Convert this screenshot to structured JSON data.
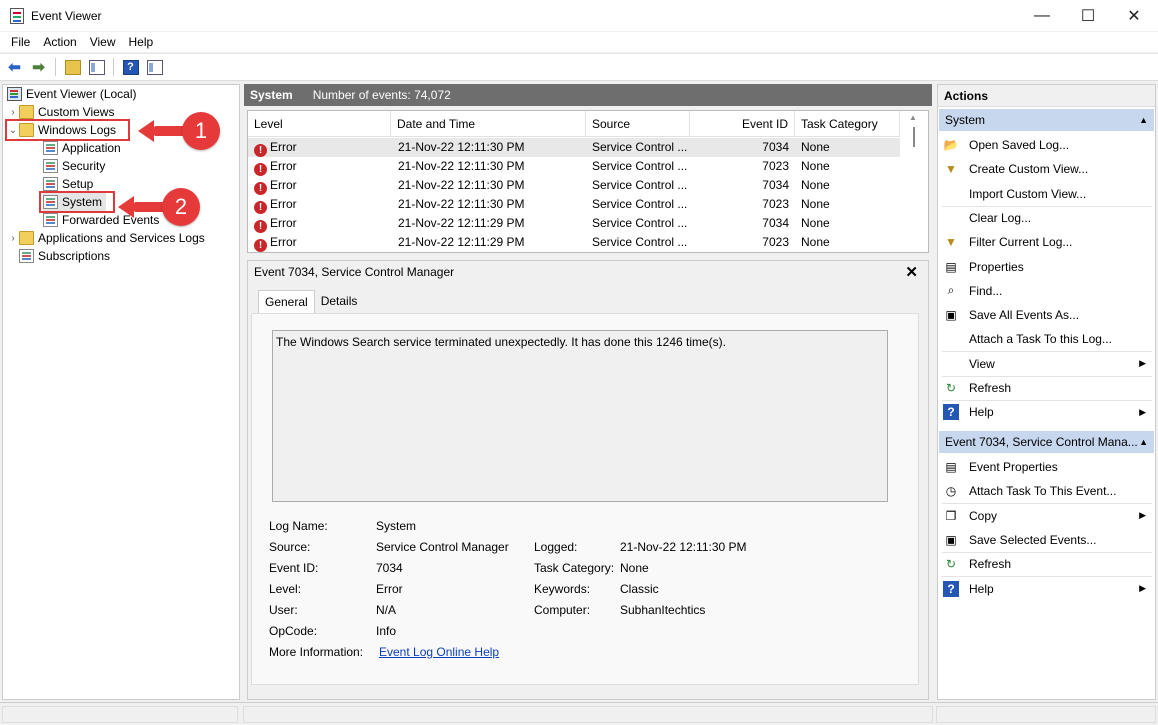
{
  "window": {
    "title": "Event Viewer",
    "minimize": "—",
    "maximize": "☐",
    "close": "✕"
  },
  "menu": [
    "File",
    "Action",
    "View",
    "Help"
  ],
  "tree": {
    "root": "Event Viewer (Local)",
    "custom_views": "Custom Views",
    "windows_logs": "Windows Logs",
    "application": "Application",
    "security": "Security",
    "setup": "Setup",
    "system": "System",
    "forwarded": "Forwarded Events",
    "apps_services": "Applications and Services Logs",
    "subscriptions": "Subscriptions"
  },
  "callouts": {
    "one": "1",
    "two": "2",
    "color": "#e63a3a"
  },
  "middle": {
    "log_name": "System",
    "event_count": "Number of events: 74,072",
    "columns": [
      "Level",
      "Date and Time",
      "Source",
      "Event ID",
      "Task Category"
    ],
    "rows": [
      {
        "level": "Error",
        "datetime": "21-Nov-22 12:11:30 PM",
        "source": "Service Control ...",
        "event_id": "7034",
        "category": "None"
      },
      {
        "level": "Error",
        "datetime": "21-Nov-22 12:11:30 PM",
        "source": "Service Control ...",
        "event_id": "7023",
        "category": "None"
      },
      {
        "level": "Error",
        "datetime": "21-Nov-22 12:11:30 PM",
        "source": "Service Control ...",
        "event_id": "7034",
        "category": "None"
      },
      {
        "level": "Error",
        "datetime": "21-Nov-22 12:11:30 PM",
        "source": "Service Control ...",
        "event_id": "7023",
        "category": "None"
      },
      {
        "level": "Error",
        "datetime": "21-Nov-22 12:11:29 PM",
        "source": "Service Control ...",
        "event_id": "7034",
        "category": "None"
      },
      {
        "level": "Error",
        "datetime": "21-Nov-22 12:11:29 PM",
        "source": "Service Control ...",
        "event_id": "7023",
        "category": "None"
      }
    ]
  },
  "detail": {
    "title": "Event 7034, Service Control Manager",
    "tabs": [
      "General",
      "Details"
    ],
    "description": "The Windows Search service terminated unexpectedly.  It has done this 1246 time(s).",
    "labels": {
      "log_name": "Log Name:",
      "source": "Source:",
      "event_id": "Event ID:",
      "level": "Level:",
      "user": "User:",
      "opcode": "OpCode:",
      "more_info": "More Information:",
      "logged": "Logged:",
      "task_category": "Task Category:",
      "keywords": "Keywords:",
      "computer": "Computer:"
    },
    "values": {
      "log_name": "System",
      "source": "Service Control Manager",
      "event_id": "7034",
      "level": "Error",
      "user": "N/A",
      "opcode": "Info",
      "more_info_link": "Event Log Online Help",
      "logged": "21-Nov-22 12:11:30 PM",
      "task_category": "None",
      "keywords": "Classic",
      "computer": "SubhanItechtics"
    }
  },
  "actions": {
    "title": "Actions",
    "group1": "System",
    "items1": [
      {
        "label": "Open Saved Log...",
        "icon": "folder-open-icon",
        "glyph": "📂"
      },
      {
        "label": "Create Custom View...",
        "icon": "filter-icon",
        "glyph": "▼"
      },
      {
        "label": "Import Custom View...",
        "icon": "",
        "glyph": ""
      },
      {
        "label": "Clear Log...",
        "icon": "",
        "glyph": ""
      },
      {
        "label": "Filter Current Log...",
        "icon": "filter-icon",
        "glyph": "▼"
      },
      {
        "label": "Properties",
        "icon": "properties-icon",
        "glyph": "▤"
      },
      {
        "label": "Find...",
        "icon": "binoculars-icon",
        "glyph": "⌕"
      },
      {
        "label": "Save All Events As...",
        "icon": "save-icon",
        "glyph": "▣"
      },
      {
        "label": "Attach a Task To this Log...",
        "icon": "",
        "glyph": ""
      },
      {
        "label": "View",
        "icon": "",
        "glyph": ""
      },
      {
        "label": "Refresh",
        "icon": "refresh-icon",
        "glyph": "↻"
      },
      {
        "label": "Help",
        "icon": "help-icon",
        "glyph": "?"
      }
    ],
    "group2": "Event 7034, Service Control Mana...",
    "items2": [
      {
        "label": "Event Properties",
        "icon": "properties-icon",
        "glyph": "▤"
      },
      {
        "label": "Attach Task To This Event...",
        "icon": "task-icon",
        "glyph": "◷"
      },
      {
        "label": "Copy",
        "icon": "copy-icon",
        "glyph": "❐"
      },
      {
        "label": "Save Selected Events...",
        "icon": "save-icon",
        "glyph": "▣"
      },
      {
        "label": "Refresh",
        "icon": "refresh-icon",
        "glyph": "↻"
      },
      {
        "label": "Help",
        "icon": "help-icon",
        "glyph": "?"
      }
    ]
  }
}
